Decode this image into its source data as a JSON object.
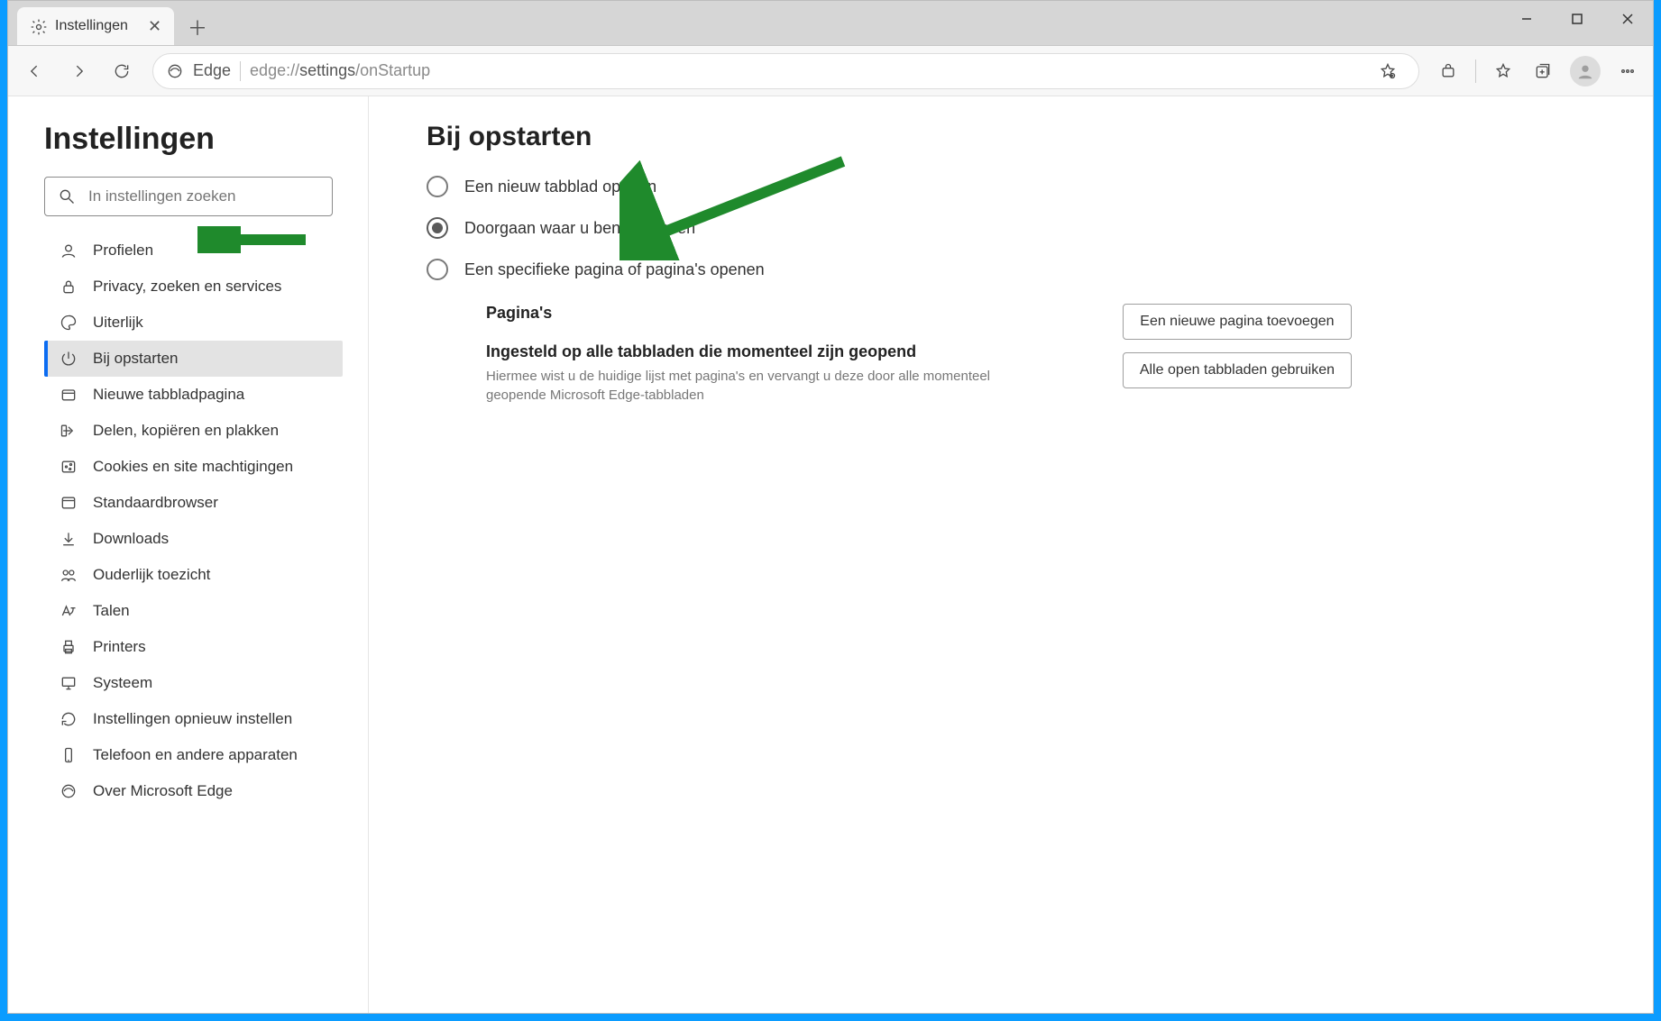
{
  "tab": {
    "title": "Instellingen"
  },
  "address": {
    "label": "Edge",
    "url_prefix": "edge://",
    "url_mid": "settings",
    "url_suffix": "/onStartup"
  },
  "sidebar": {
    "heading": "Instellingen",
    "search_placeholder": "In instellingen zoeken",
    "items": [
      {
        "label": "Profielen"
      },
      {
        "label": "Privacy, zoeken en services"
      },
      {
        "label": "Uiterlijk"
      },
      {
        "label": "Bij opstarten"
      },
      {
        "label": "Nieuwe tabbladpagina"
      },
      {
        "label": "Delen, kopiëren en plakken"
      },
      {
        "label": "Cookies en site machtigingen"
      },
      {
        "label": "Standaardbrowser"
      },
      {
        "label": "Downloads"
      },
      {
        "label": "Ouderlijk toezicht"
      },
      {
        "label": "Talen"
      },
      {
        "label": "Printers"
      },
      {
        "label": "Systeem"
      },
      {
        "label": "Instellingen opnieuw instellen"
      },
      {
        "label": "Telefoon en andere apparaten"
      },
      {
        "label": "Over Microsoft Edge"
      }
    ]
  },
  "main": {
    "heading": "Bij opstarten",
    "options": [
      {
        "label": "Een nieuw tabblad openen",
        "selected": false
      },
      {
        "label": "Doorgaan waar u bent gebleven",
        "selected": true
      },
      {
        "label": "Een specifieke pagina of pagina's openen",
        "selected": false
      }
    ],
    "pages_header": "Pagina's",
    "all_tabs_title": "Ingesteld op alle tabbladen die momenteel zijn geopend",
    "all_tabs_desc": "Hiermee wist u de huidige lijst met pagina's en vervangt u deze door alle momenteel geopende Microsoft Edge-tabbladen",
    "btn_add_page": "Een nieuwe pagina toevoegen",
    "btn_use_open_tabs": "Alle open tabbladen gebruiken"
  }
}
